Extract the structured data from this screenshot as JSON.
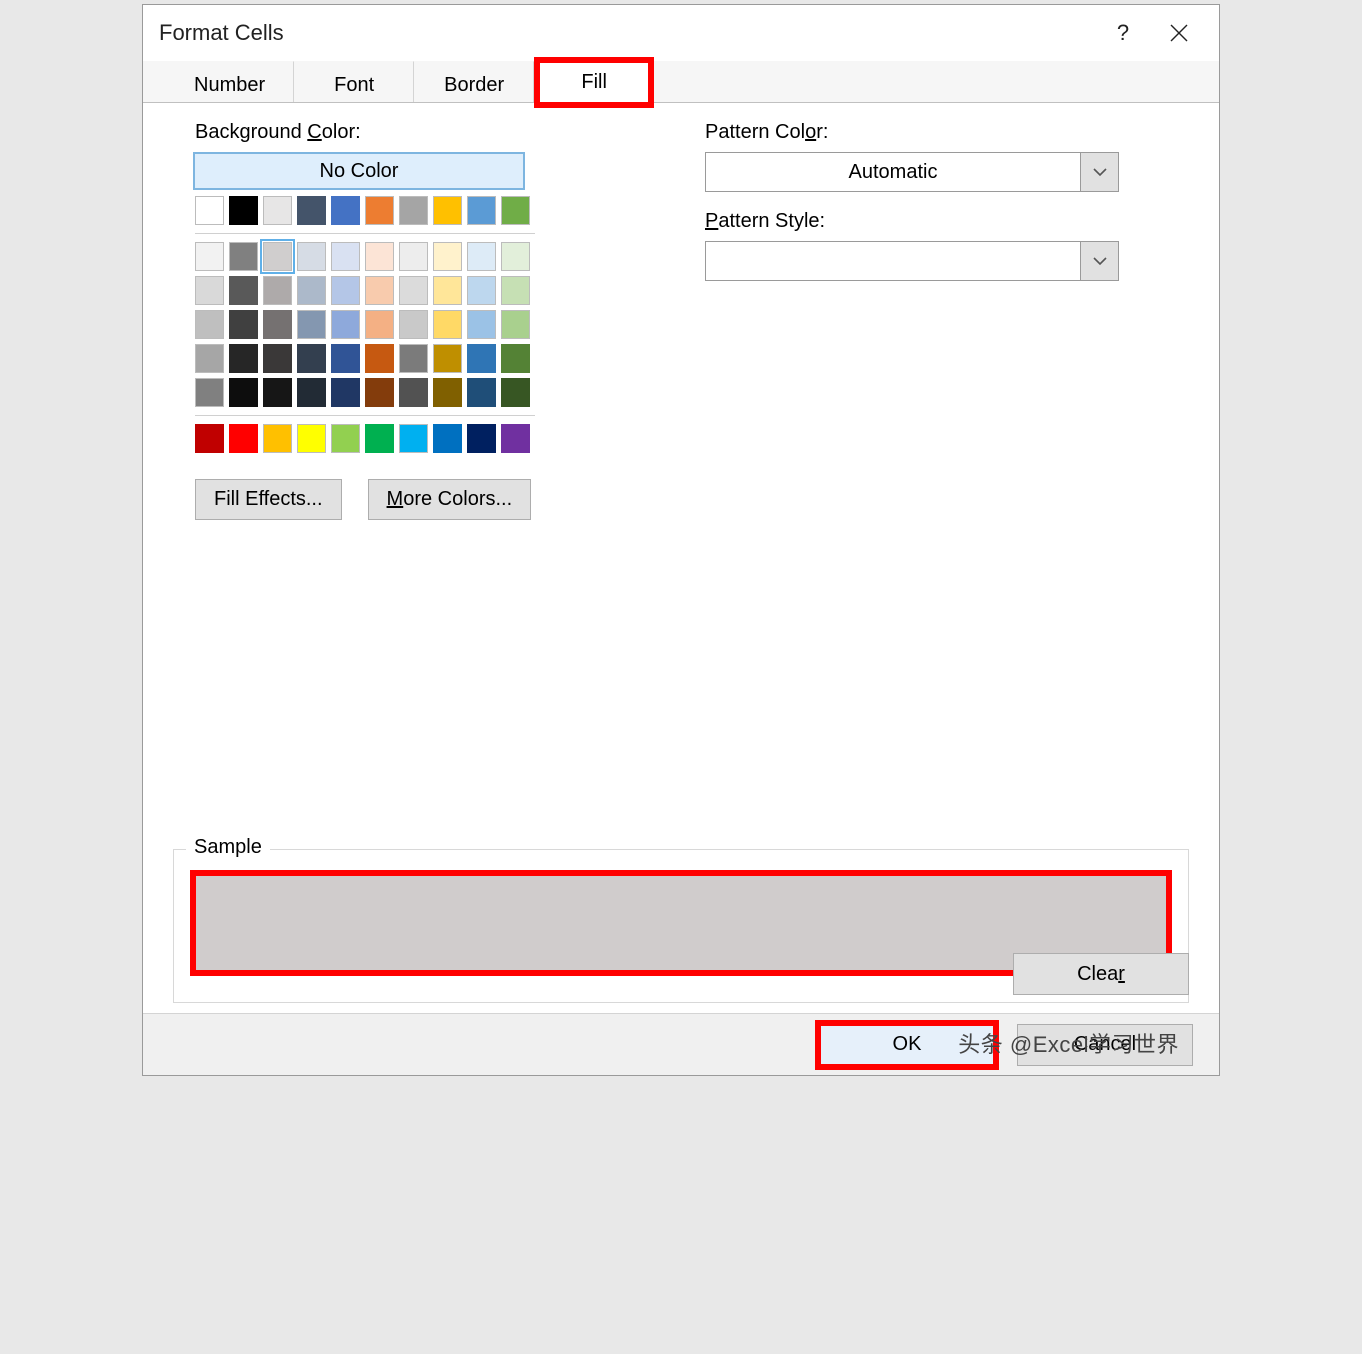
{
  "window": {
    "title": "Format Cells"
  },
  "tabs": [
    "Number",
    "Font",
    "Border",
    "Fill"
  ],
  "labels": {
    "bg_color_pre": "Background ",
    "bg_color_u": "C",
    "bg_color_post": "olor:",
    "no_color": "No Color",
    "fill_effects": "Fill Effects...",
    "more_colors_u": "M",
    "more_colors_post": "ore Colors...",
    "pattern_color_pre": "Pattern Col",
    "pattern_color_u": "o",
    "pattern_color_post": "r:",
    "pattern_style_u": "P",
    "pattern_style_post": "attern Style:",
    "automatic": "Automatic",
    "sample": "Sample",
    "clear_u": "r",
    "clear_pre": "Clea",
    "ok": "OK",
    "cancel": "Cancel"
  },
  "sample_color": "#d0cccc",
  "watermark": "头条 @Excel学习世界",
  "theme_row": [
    "#ffffff",
    "#000000",
    "#e7e6e6",
    "#44546a",
    "#4472c4",
    "#ed7d31",
    "#a5a5a5",
    "#ffc000",
    "#5b9bd5",
    "#70ad47"
  ],
  "tint_rows": [
    [
      "#f2f2f2",
      "#808080",
      "#d0cece",
      "#d6dce5",
      "#d9e1f2",
      "#fce4d6",
      "#ededed",
      "#fff2cc",
      "#ddebf7",
      "#e2efda"
    ],
    [
      "#d9d9d9",
      "#595959",
      "#aeaaaa",
      "#acb9ca",
      "#b4c6e7",
      "#f8cbad",
      "#dbdbdb",
      "#ffe699",
      "#bdd7ee",
      "#c6e0b4"
    ],
    [
      "#bfbfbf",
      "#404040",
      "#757171",
      "#8497b0",
      "#8ea9db",
      "#f4b084",
      "#c9c9c9",
      "#ffd966",
      "#9bc2e6",
      "#a9d08e"
    ],
    [
      "#a6a6a6",
      "#262626",
      "#3a3838",
      "#333f4f",
      "#305496",
      "#c65911",
      "#7b7b7b",
      "#bf8f00",
      "#2f75b5",
      "#548235"
    ],
    [
      "#808080",
      "#0d0d0d",
      "#161616",
      "#222b35",
      "#203764",
      "#833c0c",
      "#525252",
      "#806000",
      "#1f4e78",
      "#375623"
    ]
  ],
  "standard_row": [
    "#c00000",
    "#ff0000",
    "#ffc000",
    "#ffff00",
    "#92d050",
    "#00b050",
    "#00b0f0",
    "#0070c0",
    "#002060",
    "#7030a0"
  ]
}
